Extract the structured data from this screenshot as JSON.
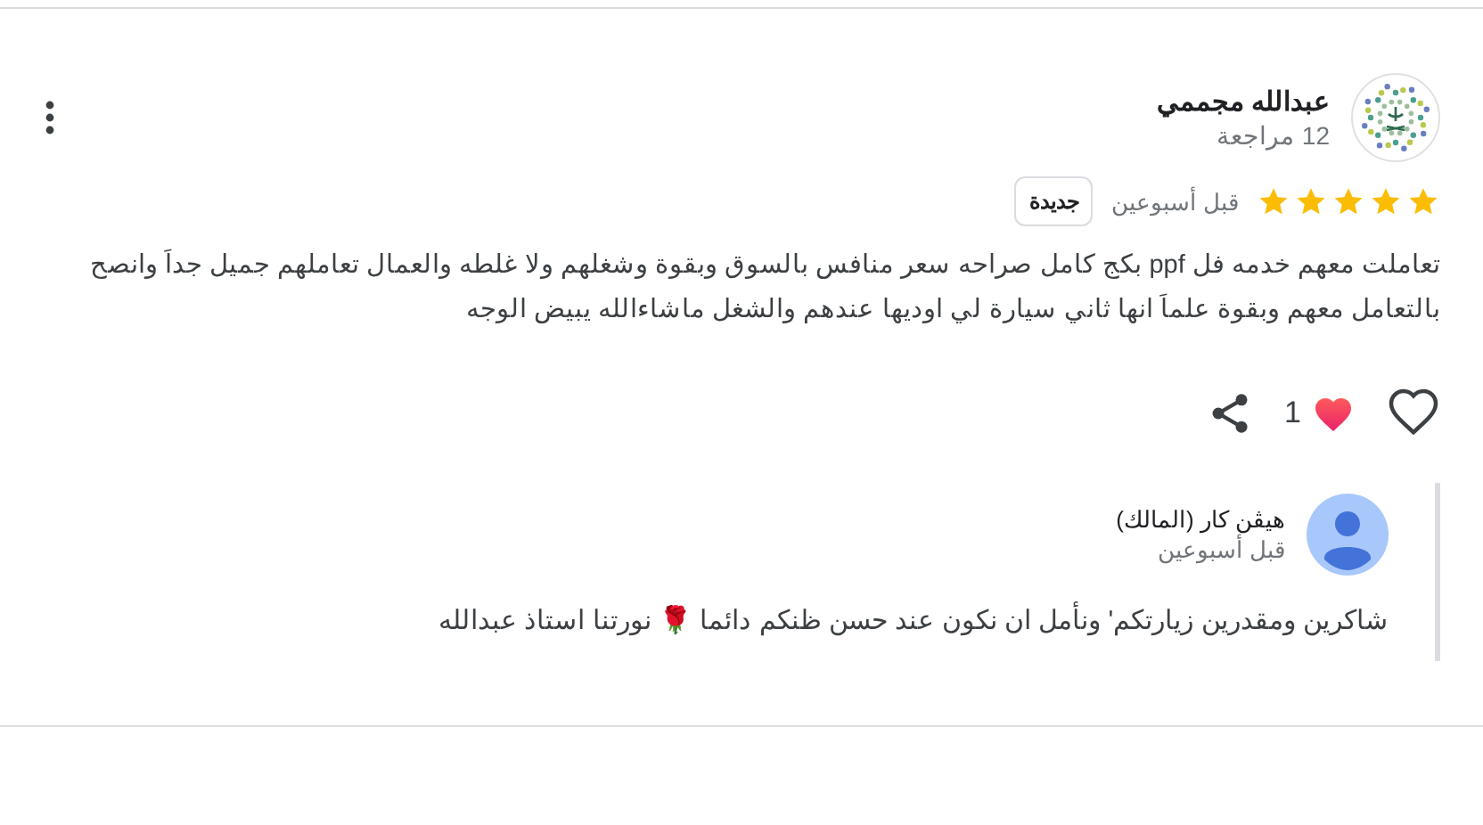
{
  "review": {
    "author": "عبدالله مجممي",
    "reviews_count": "12 مراجعة",
    "stars": 5,
    "time": "قبل أسبوعين",
    "badge": "جديدة",
    "text": "تعاملت معهم خدمه فل ppf بكج كامل صراحه سعر منافس بالسوق وبقوة وشغلهم ولا غلطه والعمال تعاملهم جميل جداَ وانصح بالتعامل معهم وبقوة علماَ انها ثاني سيارة لي اوديها عندهم والشغل ماشاءالله يبيض الوجه",
    "reaction_count": "1"
  },
  "owner_reply": {
    "author": "هيڤن كار (المالك)",
    "time": "قبل أسبوعين",
    "text": "شاكرين ومقدرين زيارتكم' ونأمل ان نكون عند حسن ظنكم دائما 🌹 نورتنا استاذ عبدالله"
  }
}
